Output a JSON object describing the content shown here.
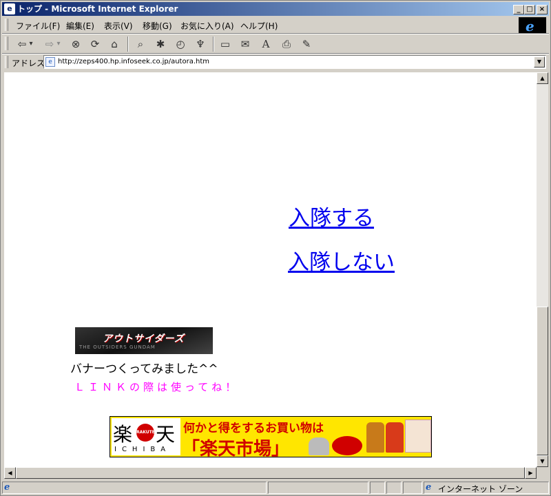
{
  "window": {
    "title": "トップ - Microsoft Internet Explorer",
    "controls": {
      "minimize": "_",
      "maximize": "□",
      "close": "×"
    }
  },
  "menubar": {
    "items": [
      {
        "label": "ファイル(F)"
      },
      {
        "label": "編集(E)"
      },
      {
        "label": "表示(V)"
      },
      {
        "label": "移動(G)"
      },
      {
        "label": "お気に入り(A)"
      },
      {
        "label": "ヘルプ(H)"
      }
    ]
  },
  "toolbar": {
    "buttons": [
      {
        "icon": "back-icon",
        "glyph": "⇦"
      },
      {
        "icon": "dropdown-icon",
        "glyph": "▾"
      },
      {
        "icon": "forward-icon",
        "glyph": "⇨"
      },
      {
        "icon": "dropdown-icon",
        "glyph": "▾"
      },
      {
        "icon": "stop-icon",
        "glyph": "⊗"
      },
      {
        "icon": "refresh-icon",
        "glyph": "⟳"
      },
      {
        "icon": "home-icon",
        "glyph": "⌂"
      },
      {
        "icon": "search-icon",
        "glyph": "⌕"
      },
      {
        "icon": "favorites-icon",
        "glyph": "✱"
      },
      {
        "icon": "history-icon",
        "glyph": "◴"
      },
      {
        "icon": "channels-icon",
        "glyph": "♆"
      },
      {
        "icon": "fullscreen-icon",
        "glyph": "▭"
      },
      {
        "icon": "mail-icon",
        "glyph": "✉"
      },
      {
        "icon": "font-icon",
        "glyph": "A"
      },
      {
        "icon": "print-icon",
        "glyph": "⎙"
      },
      {
        "icon": "edit-icon",
        "glyph": "✎"
      }
    ]
  },
  "address": {
    "label": "アドレス",
    "url": "http://zeps400.hp.infoseek.co.jp/autora.htm"
  },
  "content": {
    "link_join": "入隊する",
    "link_not_join": "入隊しない",
    "outsiders_banner_title": "アウトサイダーズ",
    "outsiders_banner_sub": "THE OUTSIDERS GUNDAM",
    "banner_caption": "バナーつくってみました^^",
    "link_note": "ＬＩＮＫの際は使ってね！",
    "rakuten_banner": {
      "logo_left": "楽",
      "logo_dot": "RAKUTEN",
      "logo_right": "天",
      "logo_sub": "ICHIBA",
      "tagline": "何かと得をするお買い物は",
      "main": "「楽天市場」"
    }
  },
  "statusbar": {
    "zone": "インターネット ゾーン"
  },
  "colors": {
    "link": "#0000ee",
    "note": "#ff00ff",
    "title_bar": "#0a246a"
  }
}
